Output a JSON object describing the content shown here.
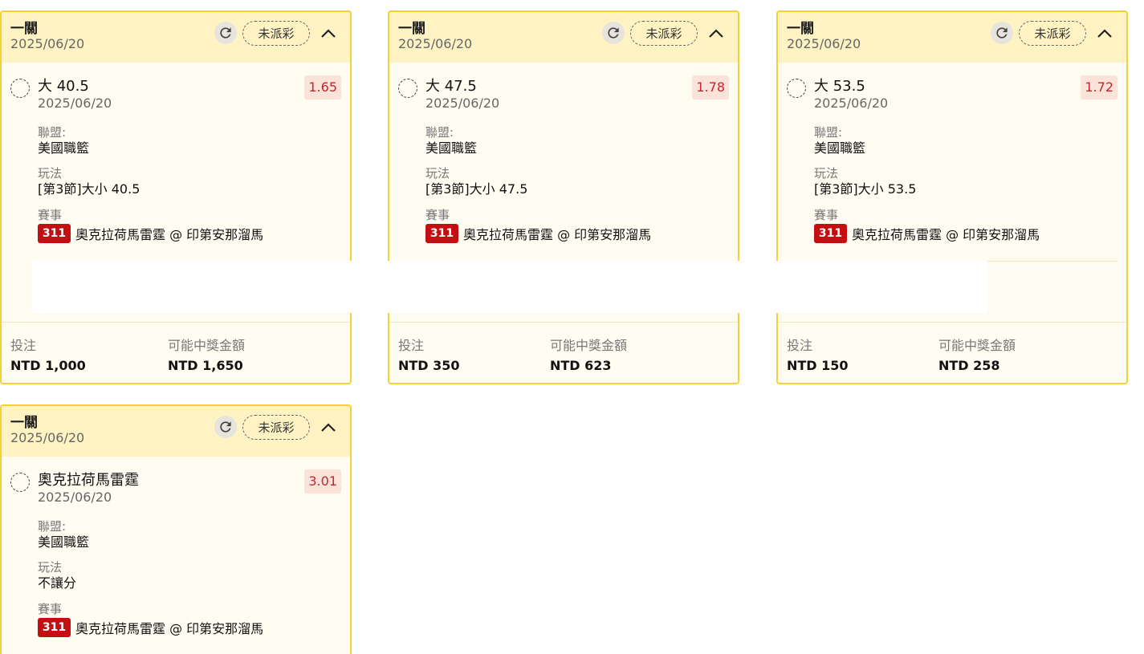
{
  "cards": [
    {
      "title": "一關",
      "date": "2025/06/20",
      "status": "未派彩",
      "bet": "大 40.5",
      "odds": "1.65",
      "bet_date": "2025/06/20",
      "league_label": "聯盟:",
      "league": "美國職籃",
      "play_label": "玩法",
      "play": "[第3節]大小 40.5",
      "event_label": "賽事",
      "event_num": "311",
      "event": "奧克拉荷馬雷霆 @ 印第安那溜馬",
      "stake_label": "投注",
      "stake": "NTD 1,000",
      "win_label": "可能中獎金額",
      "win": "NTD 1,650"
    },
    {
      "title": "一關",
      "date": "2025/06/20",
      "status": "未派彩",
      "bet": "大 47.5",
      "odds": "1.78",
      "bet_date": "2025/06/20",
      "league_label": "聯盟:",
      "league": "美國職籃",
      "play_label": "玩法",
      "play": "[第3節]大小 47.5",
      "event_label": "賽事",
      "event_num": "311",
      "event": "奧克拉荷馬雷霆 @ 印第安那溜馬",
      "stake_label": "投注",
      "stake": "NTD 350",
      "win_label": "可能中獎金額",
      "win": "NTD 623"
    },
    {
      "title": "一關",
      "date": "2025/06/20",
      "status": "未派彩",
      "bet": "大 53.5",
      "odds": "1.72",
      "bet_date": "2025/06/20",
      "league_label": "聯盟:",
      "league": "美國職籃",
      "play_label": "玩法",
      "play": "[第3節]大小 53.5",
      "event_label": "賽事",
      "event_num": "311",
      "event": "奧克拉荷馬雷霆 @ 印第安那溜馬",
      "stake_label": "投注",
      "stake": "NTD 150",
      "win_label": "可能中獎金額",
      "win": "NTD 258"
    },
    {
      "title": "一關",
      "date": "2025/06/20",
      "status": "未派彩",
      "bet": "奧克拉荷馬雷霆",
      "odds": "3.01",
      "bet_date": "2025/06/20",
      "league_label": "聯盟:",
      "league": "美國職籃",
      "play_label": "玩法",
      "play": "不讓分",
      "event_label": "賽事",
      "event_num": "311",
      "event": "奧克拉荷馬雷霆 @ 印第安那溜馬"
    }
  ]
}
